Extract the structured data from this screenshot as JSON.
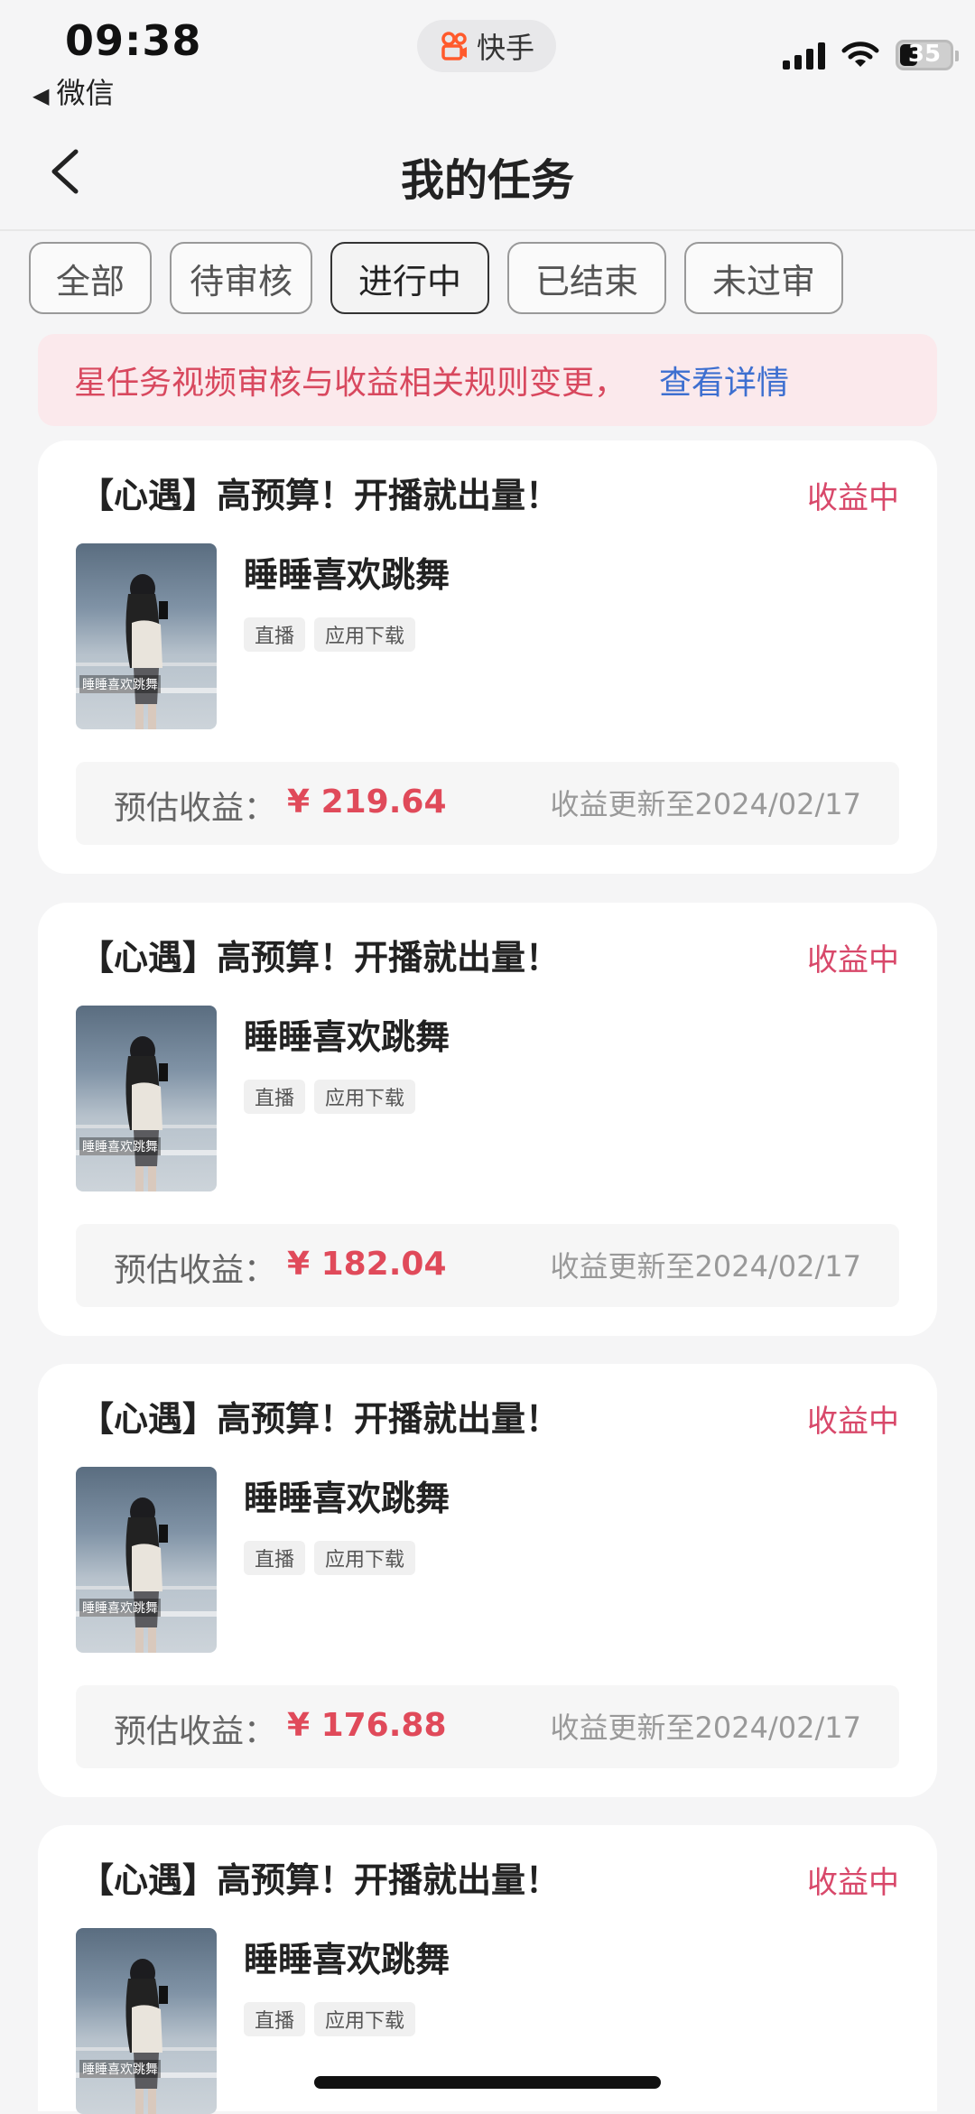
{
  "status_bar": {
    "time": "09:38",
    "back_app": "微信",
    "center_app": "快手",
    "battery": "35",
    "battery_level": 0.35
  },
  "nav": {
    "title": "我的任务"
  },
  "tabs": [
    {
      "label": "全部",
      "active": false
    },
    {
      "label": "待审核",
      "active": false
    },
    {
      "label": "进行中",
      "active": true
    },
    {
      "label": "已结束",
      "active": false
    },
    {
      "label": "未过审",
      "active": false
    }
  ],
  "notice": {
    "text": "星任务视频审核与收益相关规则变更，",
    "link": "查看详情"
  },
  "tasks": [
    {
      "title": "【心遇】高预算！开播就出量！",
      "status": "收益中",
      "name": "睡睡喜欢跳舞",
      "thumb_caption": "睡睡喜欢跳舞",
      "tags": [
        "直播",
        "应用下载"
      ],
      "earn_label": "预估收益：",
      "earn_value": "¥ 219.64",
      "earn_date": "收益更新至2024/02/17"
    },
    {
      "title": "【心遇】高预算！开播就出量！",
      "status": "收益中",
      "name": "睡睡喜欢跳舞",
      "thumb_caption": "睡睡喜欢跳舞",
      "tags": [
        "直播",
        "应用下载"
      ],
      "earn_label": "预估收益：",
      "earn_value": "¥ 182.04",
      "earn_date": "收益更新至2024/02/17"
    },
    {
      "title": "【心遇】高预算！开播就出量！",
      "status": "收益中",
      "name": "睡睡喜欢跳舞",
      "thumb_caption": "睡睡喜欢跳舞",
      "tags": [
        "直播",
        "应用下载"
      ],
      "earn_label": "预估收益：",
      "earn_value": "¥ 176.88",
      "earn_date": "收益更新至2024/02/17"
    },
    {
      "title": "【心遇】高预算！开播就出量！",
      "status": "收益中",
      "name": "睡睡喜欢跳舞",
      "thumb_caption": "睡睡喜欢跳舞",
      "tags": [
        "直播",
        "应用下载"
      ],
      "earn_label": "",
      "earn_value": "",
      "earn_date": ""
    }
  ],
  "colors": {
    "accent_red": "#e04a5a",
    "status_pink": "#d8486a",
    "link_blue": "#3d6fd0",
    "notice_bg": "#fbe9ec"
  }
}
